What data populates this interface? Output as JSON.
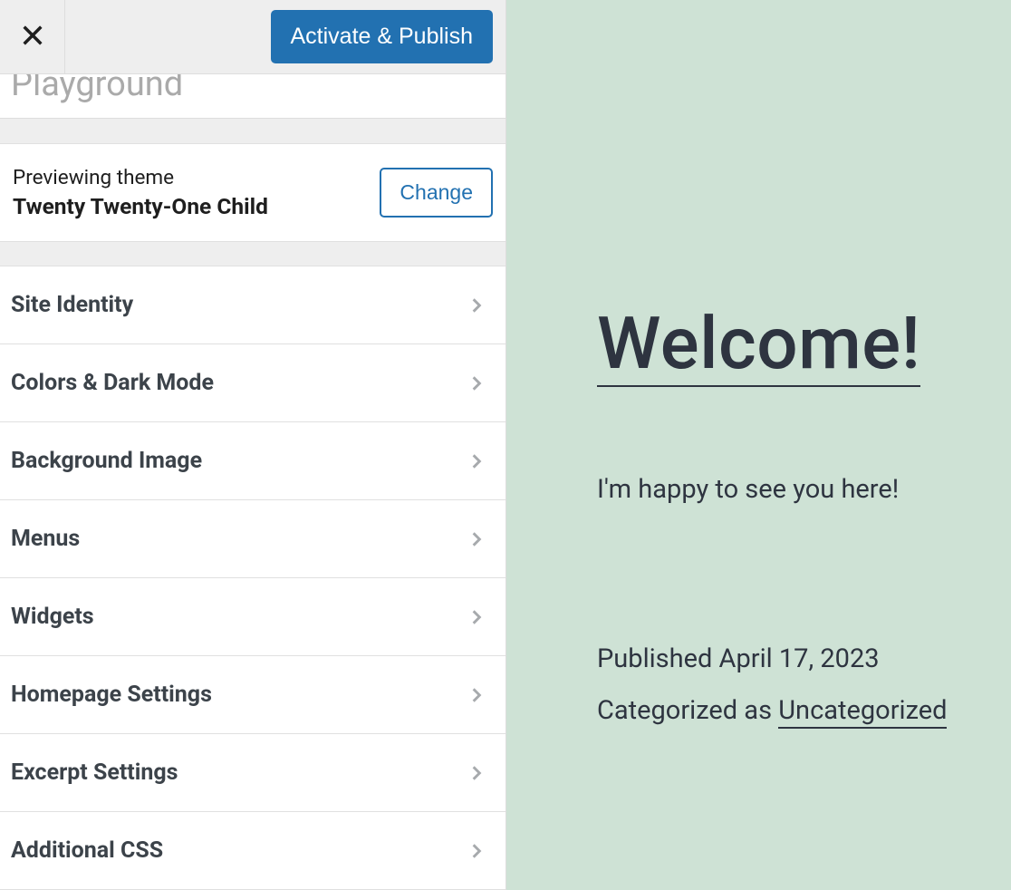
{
  "header": {
    "activate_label": "Activate & Publish"
  },
  "site_name": "Playground",
  "theme": {
    "preview_label": "Previewing theme",
    "name": "Twenty Twenty-One Child",
    "change_label": "Change"
  },
  "menu_items": [
    {
      "label": "Site Identity",
      "id": "site-identity"
    },
    {
      "label": "Colors & Dark Mode",
      "id": "colors-dark-mode"
    },
    {
      "label": "Background Image",
      "id": "background-image"
    },
    {
      "label": "Menus",
      "id": "menus"
    },
    {
      "label": "Widgets",
      "id": "widgets"
    },
    {
      "label": "Homepage Settings",
      "id": "homepage-settings"
    },
    {
      "label": "Excerpt Settings",
      "id": "excerpt-settings"
    },
    {
      "label": "Additional CSS",
      "id": "additional-css"
    }
  ],
  "preview": {
    "title": "Welcome!",
    "body": "I'm happy to see you here!",
    "published_label": "Published",
    "published_date": "April 17, 2023",
    "categorized_label": "Categorized as",
    "category": "Uncategorized"
  }
}
